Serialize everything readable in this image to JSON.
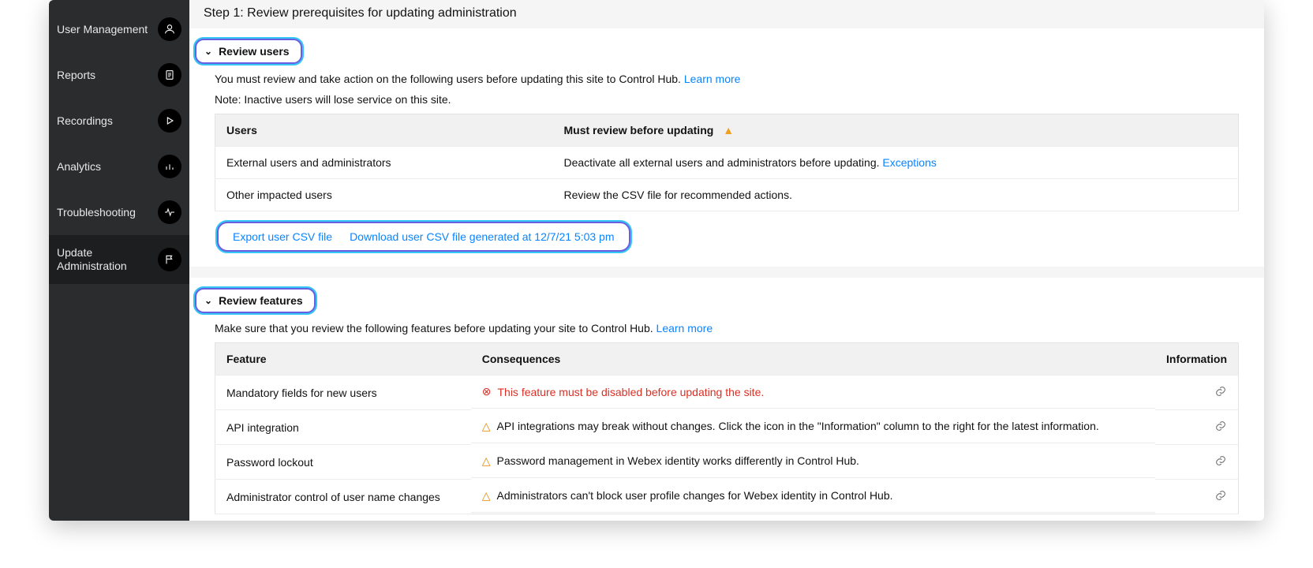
{
  "sidebar": {
    "items": [
      {
        "label": "User Management",
        "icon": "user-icon"
      },
      {
        "label": "Reports",
        "icon": "doc-icon"
      },
      {
        "label": "Recordings",
        "icon": "play-icon"
      },
      {
        "label": "Analytics",
        "icon": "bar-icon"
      },
      {
        "label": "Troubleshooting",
        "icon": "pulse-icon"
      },
      {
        "label": "Update Administration",
        "icon": "flag-icon",
        "active": true
      }
    ]
  },
  "step_title": "Step 1: Review prerequisites for updating administration",
  "review_users": {
    "heading": "Review users",
    "intro": "You must review and take action on the following users before updating this site to Control Hub.",
    "intro_link": "Learn more",
    "note": "Note: Inactive users will lose service on this site.",
    "cols": {
      "users": "Users",
      "must": "Must review before updating"
    },
    "rows": [
      {
        "user": "External users and administrators",
        "action": "Deactivate all external users and administrators before updating.",
        "link": "Exceptions"
      },
      {
        "user": "Other impacted users",
        "action": "Review the CSV file for recommended actions."
      }
    ],
    "csv": {
      "export": "Export user CSV file",
      "download": "Download user CSV file generated at 12/7/21 5:03 pm"
    }
  },
  "review_features": {
    "heading": "Review features",
    "intro": "Make sure that you review the following features before updating your site to Control Hub.",
    "intro_link": "Learn more",
    "cols": {
      "feature": "Feature",
      "consq": "Consequences",
      "info": "Information"
    },
    "rows": [
      {
        "feature": "Mandatory fields for new users",
        "severity": "error",
        "text": "This feature must be disabled before updating the site."
      },
      {
        "feature": "API integration",
        "severity": "warn",
        "text": "API integrations may break without changes. Click the icon in the \"Information\"  column to the right for the latest information."
      },
      {
        "feature": "Password lockout",
        "severity": "warn",
        "text": "Password management in Webex identity works differently in Control Hub."
      },
      {
        "feature": "Administrator control of user name changes",
        "severity": "warn",
        "text": "Administrators can't block user profile changes for Webex identity in Control Hub."
      }
    ]
  }
}
